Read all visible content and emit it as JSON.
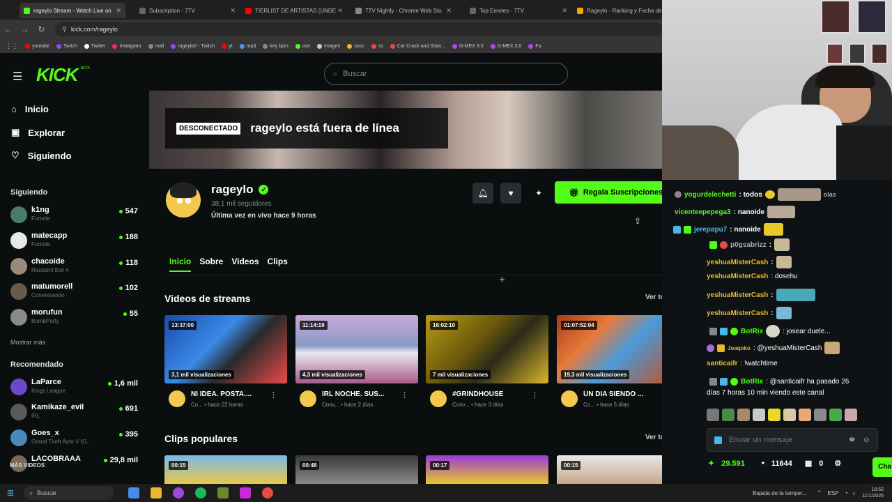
{
  "browser": {
    "tabs": [
      {
        "title": "rageylo Stream - Watch Live on",
        "color": "#53fc18",
        "active": true
      },
      {
        "title": "Subscription - 7TV",
        "color": "#3a3a3a"
      },
      {
        "title": "TIERLIST DE ARTISTAS (UNDE",
        "color": "#ff0000"
      },
      {
        "title": "7TV Nightly - Chrome Web Sto",
        "color": "#4285f4"
      },
      {
        "title": "Top Emotes - 7TV",
        "color": "#3a3a3a"
      },
      {
        "title": "Rageylo - Ranking y Fecha de",
        "color": "#f2a900"
      }
    ],
    "url": "kick.com/rageylo",
    "bookmarks": [
      "youtube",
      "Twitch",
      "Twitter",
      "Instagram",
      "mail",
      "rageylo0 - Twitch",
      "yt",
      "mp3",
      "key bpm",
      "ose",
      "Imagen",
      "sosc",
      "ss",
      "Car Crash and Stain...",
      "G-MEX 3.0",
      "G-MEX 3.0",
      "Fu"
    ]
  },
  "kick": {
    "logo": "KICK",
    "beta": "BETA",
    "search_placeholder": "Buscar",
    "nav": {
      "home": "Inicio",
      "explore": "Explorar",
      "following": "Siguiendo"
    },
    "following_title": "Siguiendo",
    "following": [
      {
        "name": "k1ng",
        "game": "Fortnite",
        "viewers": "547",
        "color": "#4a7a6a"
      },
      {
        "name": "matecapp",
        "game": "Fortnite",
        "viewers": "188",
        "color": "#e8e8e8"
      },
      {
        "name": "chacoide",
        "game": "Resident Evil 4",
        "viewers": "118",
        "color": "#9a8a7a"
      },
      {
        "name": "matumorell",
        "game": "Conversando",
        "viewers": "102",
        "color": "#6a5a4a"
      },
      {
        "name": "morufun",
        "game": "BombParty",
        "viewers": "55",
        "color": "#8a8a8a"
      }
    ],
    "show_more": "Mostrar más",
    "recommended_title": "Recomendado",
    "recommended": [
      {
        "name": "LaParce",
        "game": "Kings League",
        "viewers": "1,6 mil",
        "color": "#6a4ac8"
      },
      {
        "name": "Kamikaze_evil",
        "game": "IRL",
        "viewers": "691",
        "color": "#5a5a5a"
      },
      {
        "name": "Goes_x",
        "game": "Grand Theft Auto V (G...",
        "viewers": "395",
        "color": "#4a8ab8"
      },
      {
        "name": "LACOBRAAA",
        "game": "",
        "viewers": "29,8 mil",
        "color": "#7a6a5a"
      }
    ],
    "mas_videos": "MÁS VIDEOS"
  },
  "channel": {
    "offline_badge": "DESCONECTADO",
    "offline_text": "rageylo está fuera de línea",
    "name": "rageylo",
    "followers": "38,1 mil seguidores",
    "last_live": "Última vez en vivo hace 9 horas",
    "gift_button": "Regala Suscripciones",
    "tabs": [
      "Inicio",
      "Sobre",
      "Videos",
      "Clips"
    ],
    "videos_title": "Videos de streams",
    "see_all": "Ver todo",
    "videos": [
      {
        "duration": "13:37:00",
        "views": "3,1 mil visualizaciones",
        "title": "NI IDEA. POSTA....",
        "sub1": "Co...",
        "sub2": "hace 22 horas",
        "bg": "linear-gradient(135deg,#1a4aa8,#3a8ae8 40%,#2a2a2a 60%,#e84a4a)"
      },
      {
        "duration": "11:14:19",
        "views": "4,3 mil visualizaciones",
        "title": "IRL NOCHE. SUS...",
        "sub1": "Conv...",
        "sub2": "hace 2 días",
        "bg": "linear-gradient(180deg,#c8a8d8,#8a9ac8 45%,#e8e8f0 55%,#a85a8a)"
      },
      {
        "duration": "16:02:10",
        "views": "7 mil visualizaciones",
        "title": "#GRINDHOUSE",
        "sub1": "Conv...",
        "sub2": "hace 3 días",
        "bg": "linear-gradient(135deg,#b89a1a,#6a5a0a 40%,#2a2a1a 60%,#d8b82a)"
      },
      {
        "duration": "01:07:52:04",
        "views": "19,3 mil visualizaciones",
        "title": "UN DIA SIENDO ...",
        "sub1": "Co...",
        "sub2": "hace 5 días",
        "bg": "linear-gradient(135deg,#a83a1a,#e87a3a 30%,#4a9ad8 55%,#c84a1a)"
      }
    ],
    "clips_title": "Clips populares",
    "clips": [
      {
        "duration": "00:15",
        "bg": "linear-gradient(180deg,#7ab8e8,#e8c84a)"
      },
      {
        "duration": "00:48",
        "bg": "linear-gradient(180deg,#3a3a3a,#8a8a8a)"
      },
      {
        "duration": "00:17",
        "bg": "linear-gradient(180deg,#9a3ad8,#e8c82a)"
      },
      {
        "duration": "00:15",
        "bg": "linear-gradient(180deg,#e8e8e8,#c8a88a)"
      }
    ]
  },
  "chat": {
    "messages": [
      {
        "user": "yogurdelechetti",
        "text": ": todos",
        "color": "#53fc18"
      },
      {
        "user": "vicenteepepega3",
        "text": ": nanoide",
        "color": "#53fc18"
      },
      {
        "user": "jerepapu7",
        "text": ": nanoide",
        "color": "#4ab8e8"
      },
      {
        "user": "p0gsabrizz",
        "text": ":",
        "color": "#aaaaaa"
      },
      {
        "user": "yeshuaMisterCash",
        "text": ":",
        "color": "#e8b82a"
      },
      {
        "user": "yeshuaMisterCash",
        "text": ": dosehu",
        "color": "#e8b82a"
      },
      {
        "user": "yeshuaMisterCash",
        "text": ":",
        "color": "#e8b82a"
      },
      {
        "user": "yeshuaMisterCash",
        "text": ":",
        "color": "#e8b82a"
      },
      {
        "user": "BotRix",
        "text": ": josear duele...",
        "color": "#53fc18"
      },
      {
        "user": "Joaqoko",
        "text": ": @yeshuaMisterCash",
        "color": "#e8b82a"
      },
      {
        "user": "santicaifr",
        "text": ": !watchtime",
        "color": "#e8b82a"
      },
      {
        "user": "BotRix",
        "text": ": @santicaifr ha pasado 26",
        "color": "#53fc18"
      }
    ],
    "botrix_cont": "días 7 horas 10 min viendo este canal",
    "input_placeholder": "Enviar un mensaje",
    "points": "29.591",
    "kicks": "11644",
    "count": "0",
    "chat_button": "Cha"
  },
  "taskbar": {
    "search": "Buscar",
    "weather": "Bajada de la temper...",
    "lang": "ESP",
    "time": "18:52",
    "date": "11/1/2026"
  }
}
